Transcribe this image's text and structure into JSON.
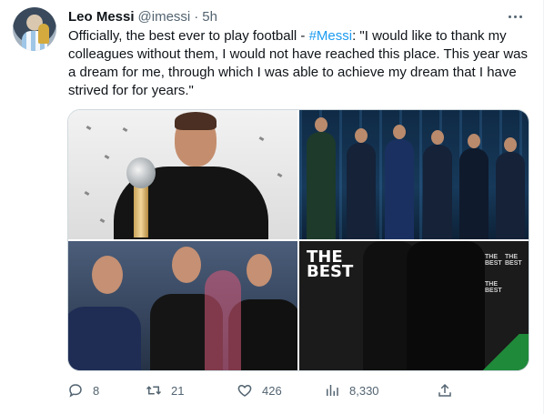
{
  "tweet": {
    "author_name": "Leo Messi",
    "handle": "@imessi",
    "separator": "·",
    "time": "5h",
    "text_before": "Officially, the best ever to play football - ",
    "hashtag": "#Messi",
    "text_after": ": \"I would like to thank my colleagues without them, I would not have reached this place. This year was a dream for me, through which I was able to achieve my dream that I have strived for for years.\"",
    "media_logo_line1": "THE",
    "media_logo_line2": "BEST"
  },
  "actions": {
    "replies": "8",
    "retweets": "21",
    "likes": "426",
    "views": "8,330"
  },
  "colors": {
    "text": "#0f1419",
    "secondary": "#536471",
    "link": "#1d9bf0",
    "border": "#cfd9de"
  },
  "icons": [
    "avatar",
    "more-icon",
    "reply-icon",
    "retweet-icon",
    "like-icon",
    "views-icon",
    "share-icon"
  ]
}
